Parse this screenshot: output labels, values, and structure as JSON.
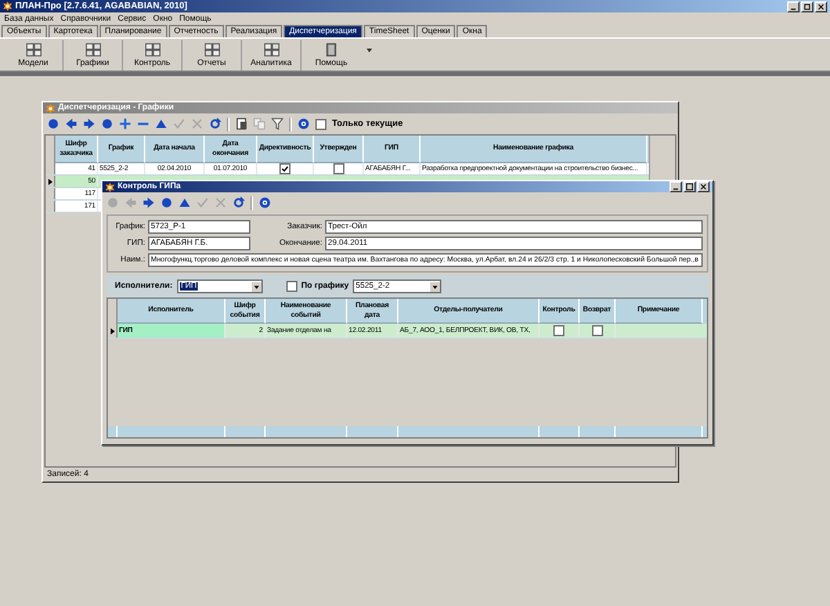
{
  "window": {
    "title": "ПЛАН-Про [2.7.6.41, AGABABIAN, 2010]"
  },
  "menu": [
    "База данных",
    "Справочники",
    "Сервис",
    "Окно",
    "Помощь"
  ],
  "tabs": [
    {
      "label": "Объекты",
      "selected": false
    },
    {
      "label": "Картотека",
      "selected": false
    },
    {
      "label": "Планирование",
      "selected": false
    },
    {
      "label": "Отчетность",
      "selected": false
    },
    {
      "label": "Реализация",
      "selected": false
    },
    {
      "label": "Диспетчеризация",
      "selected": true
    },
    {
      "label": "TimeSheet",
      "selected": false
    },
    {
      "label": "Оценки",
      "selected": false
    },
    {
      "label": "Окна",
      "selected": false
    }
  ],
  "ribbon": [
    "Модели",
    "Графики",
    "Контроль",
    "Отчеты",
    "Аналитика",
    "Помощь"
  ],
  "schedules_window": {
    "title": "Диспетчеризация - Графики",
    "toolbar": [
      {
        "disabled": false
      },
      {
        "disabled": false
      },
      {
        "disabled": false
      },
      {
        "disabled": false
      },
      {
        "disabled": false
      },
      {
        "disabled": false
      },
      {
        "disabled": false
      },
      {
        "disabled": true
      },
      {
        "disabled": true
      },
      {
        "disabled": false
      },
      {
        "disabled": false
      },
      {
        "disabled": true
      },
      {
        "disabled": false
      },
      {
        "disabled": false
      }
    ],
    "only_current": {
      "label": "Только текущие",
      "checked": false
    },
    "table": {
      "columns": [
        "Шифр заказчика",
        "График",
        "Дата начала",
        "Дата окончания",
        "Директивность",
        "Утвержден",
        "ГИП",
        "Наименование графика"
      ],
      "rows": [
        {
          "selected": false,
          "cells": [
            {
              "text": "41"
            },
            {
              "text": "5525_2-2"
            },
            {
              "text": "02.04.2010"
            },
            {
              "text": "01.07.2010"
            },
            {
              "checked": true
            },
            {
              "checked": false
            },
            {
              "text": "АГАБАБЯН Г..."
            },
            {
              "text": "Разработка предпроектной документации на строительство бизнес..."
            }
          ]
        },
        {
          "selected": true,
          "cells": [
            {
              "text": "50"
            }
          ]
        },
        {
          "selected": false,
          "cells": [
            {
              "text": "117"
            }
          ]
        },
        {
          "selected": false,
          "cells": [
            {
              "text": "171"
            }
          ]
        }
      ]
    },
    "status": "Записей: 4"
  },
  "dialog": {
    "title": "Контроль ГИПа",
    "toolbar": [
      {
        "disabled": true
      },
      {
        "disabled": true
      },
      {
        "disabled": false
      },
      {
        "disabled": false
      },
      {
        "disabled": false
      },
      {
        "disabled": true
      },
      {
        "disabled": true
      },
      {
        "disabled": false
      },
      {
        "disabled": false
      }
    ],
    "fields": [
      {
        "label": "График:",
        "value": "5723_Р-1"
      },
      {
        "label": "Заказчик:",
        "value": "Трест-Ойл"
      },
      {
        "label": "ГИП:",
        "value": "АГАБАБЯН Г.Б."
      },
      {
        "label": "Окончание:",
        "value": "29.04.2011"
      },
      {
        "label": "Наим.:",
        "value": "Многофункц.торгово деловой комплекс и новая сцена театра им. Вахтангова по адресу: Москва, ул.Арбат, вл.24 и 26/2/3 стр. 1 и Николопесковский Большой пер.,в"
      }
    ],
    "performers": {
      "label": "Исполнители:",
      "value": "ГИП"
    },
    "by_schedule": {
      "label": "По графику",
      "checked": false,
      "value": "5525_2-2"
    },
    "table": {
      "columns": [
        "Исполнитель",
        "Шифр события",
        "Наименование событий",
        "Плановая дата",
        "Отделы-получатели",
        "Контроль",
        "Возврат",
        "Примечание"
      ],
      "rows": [
        {
          "selected": true,
          "cells": [
            {
              "text": "ГИП"
            },
            {
              "text": "2"
            },
            {
              "text": "Задание отделам на"
            },
            {
              "text": "12.02.2011"
            },
            {
              "text": "АБ_7, АОО_1, БЕЛПРОЕКТ, ВИК, ОВ, ТХ,"
            },
            {
              "checked": false
            },
            {
              "checked": false
            }
          ]
        }
      ]
    }
  }
}
